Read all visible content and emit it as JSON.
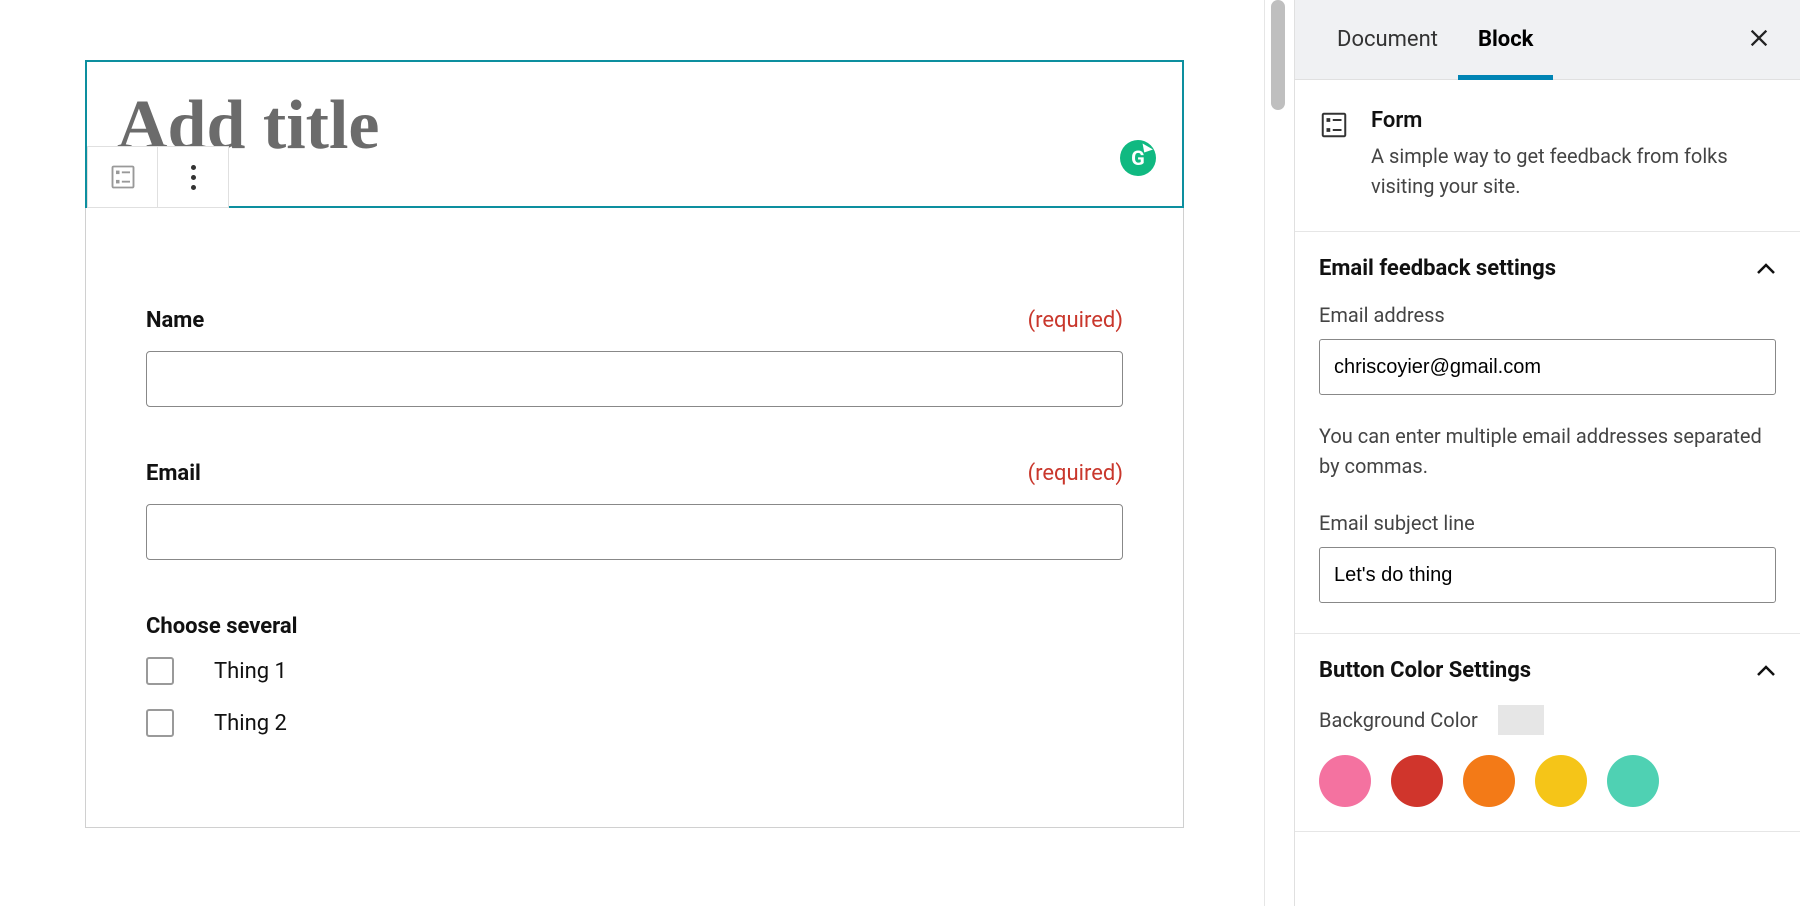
{
  "editor": {
    "title_placeholder": "Add title",
    "grammarly_letter": "G",
    "form": {
      "fields": [
        {
          "label": "Name",
          "required": "(required)"
        },
        {
          "label": "Email",
          "required": "(required)"
        }
      ],
      "checkbox_group_label": "Choose several",
      "options": [
        "Thing 1",
        "Thing 2"
      ]
    }
  },
  "sidebar": {
    "tabs": {
      "document": "Document",
      "block": "Block"
    },
    "block": {
      "name": "Form",
      "description": "A simple way to get feedback from folks visiting your site."
    },
    "email_panel": {
      "title": "Email feedback settings",
      "email_label": "Email address",
      "email_value": "chriscoyier@gmail.com",
      "email_help": "You can enter multiple email addresses separated by commas.",
      "subject_label": "Email subject line",
      "subject_value": "Let's do thing"
    },
    "button_panel": {
      "title": "Button Color Settings",
      "bg_label": "Background Color",
      "colors": [
        "#f472a0",
        "#d0352c",
        "#f37a17",
        "#f5c518",
        "#4fd1b3"
      ]
    }
  }
}
